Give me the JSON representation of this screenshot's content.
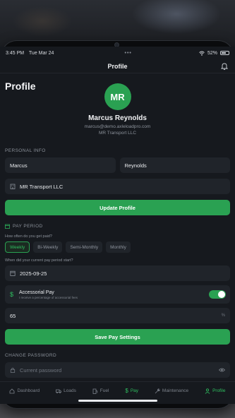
{
  "status_bar": {
    "time": "3:45 PM",
    "date": "Tue Mar 24",
    "battery": "52%"
  },
  "header": {
    "title": "Profile"
  },
  "page": {
    "title": "Profile"
  },
  "profile": {
    "initials": "MR",
    "name": "Marcus Reynolds",
    "email": "marcus@demo.axleloadpro.com",
    "company": "MR Transport LLC"
  },
  "personal_info": {
    "label": "PERSONAL INFO",
    "first_name": "Marcus",
    "last_name": "Reynolds",
    "company": "MR Transport LLC",
    "update_button": "Update Profile"
  },
  "pay_period": {
    "label": "PAY PERIOD",
    "question": "How often do you get paid?",
    "options": [
      "Weekly",
      "Bi-Weekly",
      "Semi-Monthly",
      "Monthly"
    ],
    "selected": "Weekly",
    "start_question": "When did your current pay period start?",
    "start_date": "2025-09-25",
    "accessorial_title": "Accessorial Pay",
    "accessorial_sub": "I receive a percentage of accessorial fees",
    "accessorial_enabled": true,
    "percentage": "65",
    "percentage_unit": "%",
    "save_button": "Save Pay Settings"
  },
  "change_password": {
    "label": "CHANGE PASSWORD",
    "current_placeholder": "Current password"
  },
  "tabs": [
    {
      "label": "Dashboard",
      "icon": "home-icon"
    },
    {
      "label": "Loads",
      "icon": "truck-icon"
    },
    {
      "label": "Fuel",
      "icon": "fuel-icon"
    },
    {
      "label": "Pay",
      "icon": "dollar-icon"
    },
    {
      "label": "Maintenance",
      "icon": "wrench-icon"
    },
    {
      "label": "Profile",
      "icon": "person-icon"
    }
  ],
  "colors": {
    "accent": "#2aa152",
    "background": "#16191e",
    "field": "#20242a"
  }
}
